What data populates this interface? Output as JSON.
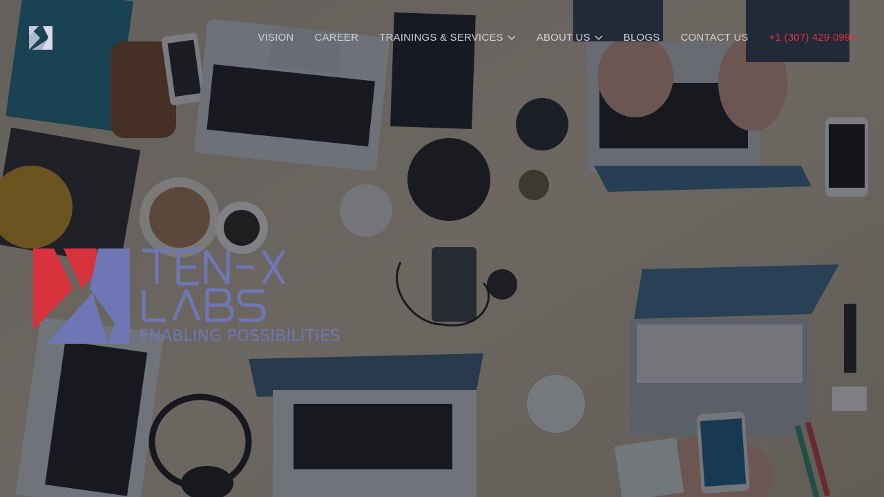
{
  "brand": {
    "wordmark_line1": "TEN-X",
    "wordmark_line2": "LABS",
    "tagline": "ENABLING POSSIBILITIES",
    "colors": {
      "red": "#d8323c",
      "indigo": "#6f76b6"
    }
  },
  "nav": {
    "items": [
      {
        "label": "VISION",
        "has_dropdown": false
      },
      {
        "label": "CAREER",
        "has_dropdown": false
      },
      {
        "label": "TRAININGS & SERVICES",
        "has_dropdown": true
      },
      {
        "label": "ABOUT US",
        "has_dropdown": true
      },
      {
        "label": "BLOGS",
        "has_dropdown": false
      },
      {
        "label": "CONTACT US",
        "has_dropdown": false
      }
    ],
    "phone": "+1 (307) 429 0994",
    "colors": {
      "text": "#cfd1d8",
      "phone": "#e0313d"
    },
    "icons": {
      "logo": "tenx-logo-icon",
      "dropdown": "chevron-down-icon"
    }
  },
  "background": {
    "description_icon": "desk-photo"
  }
}
